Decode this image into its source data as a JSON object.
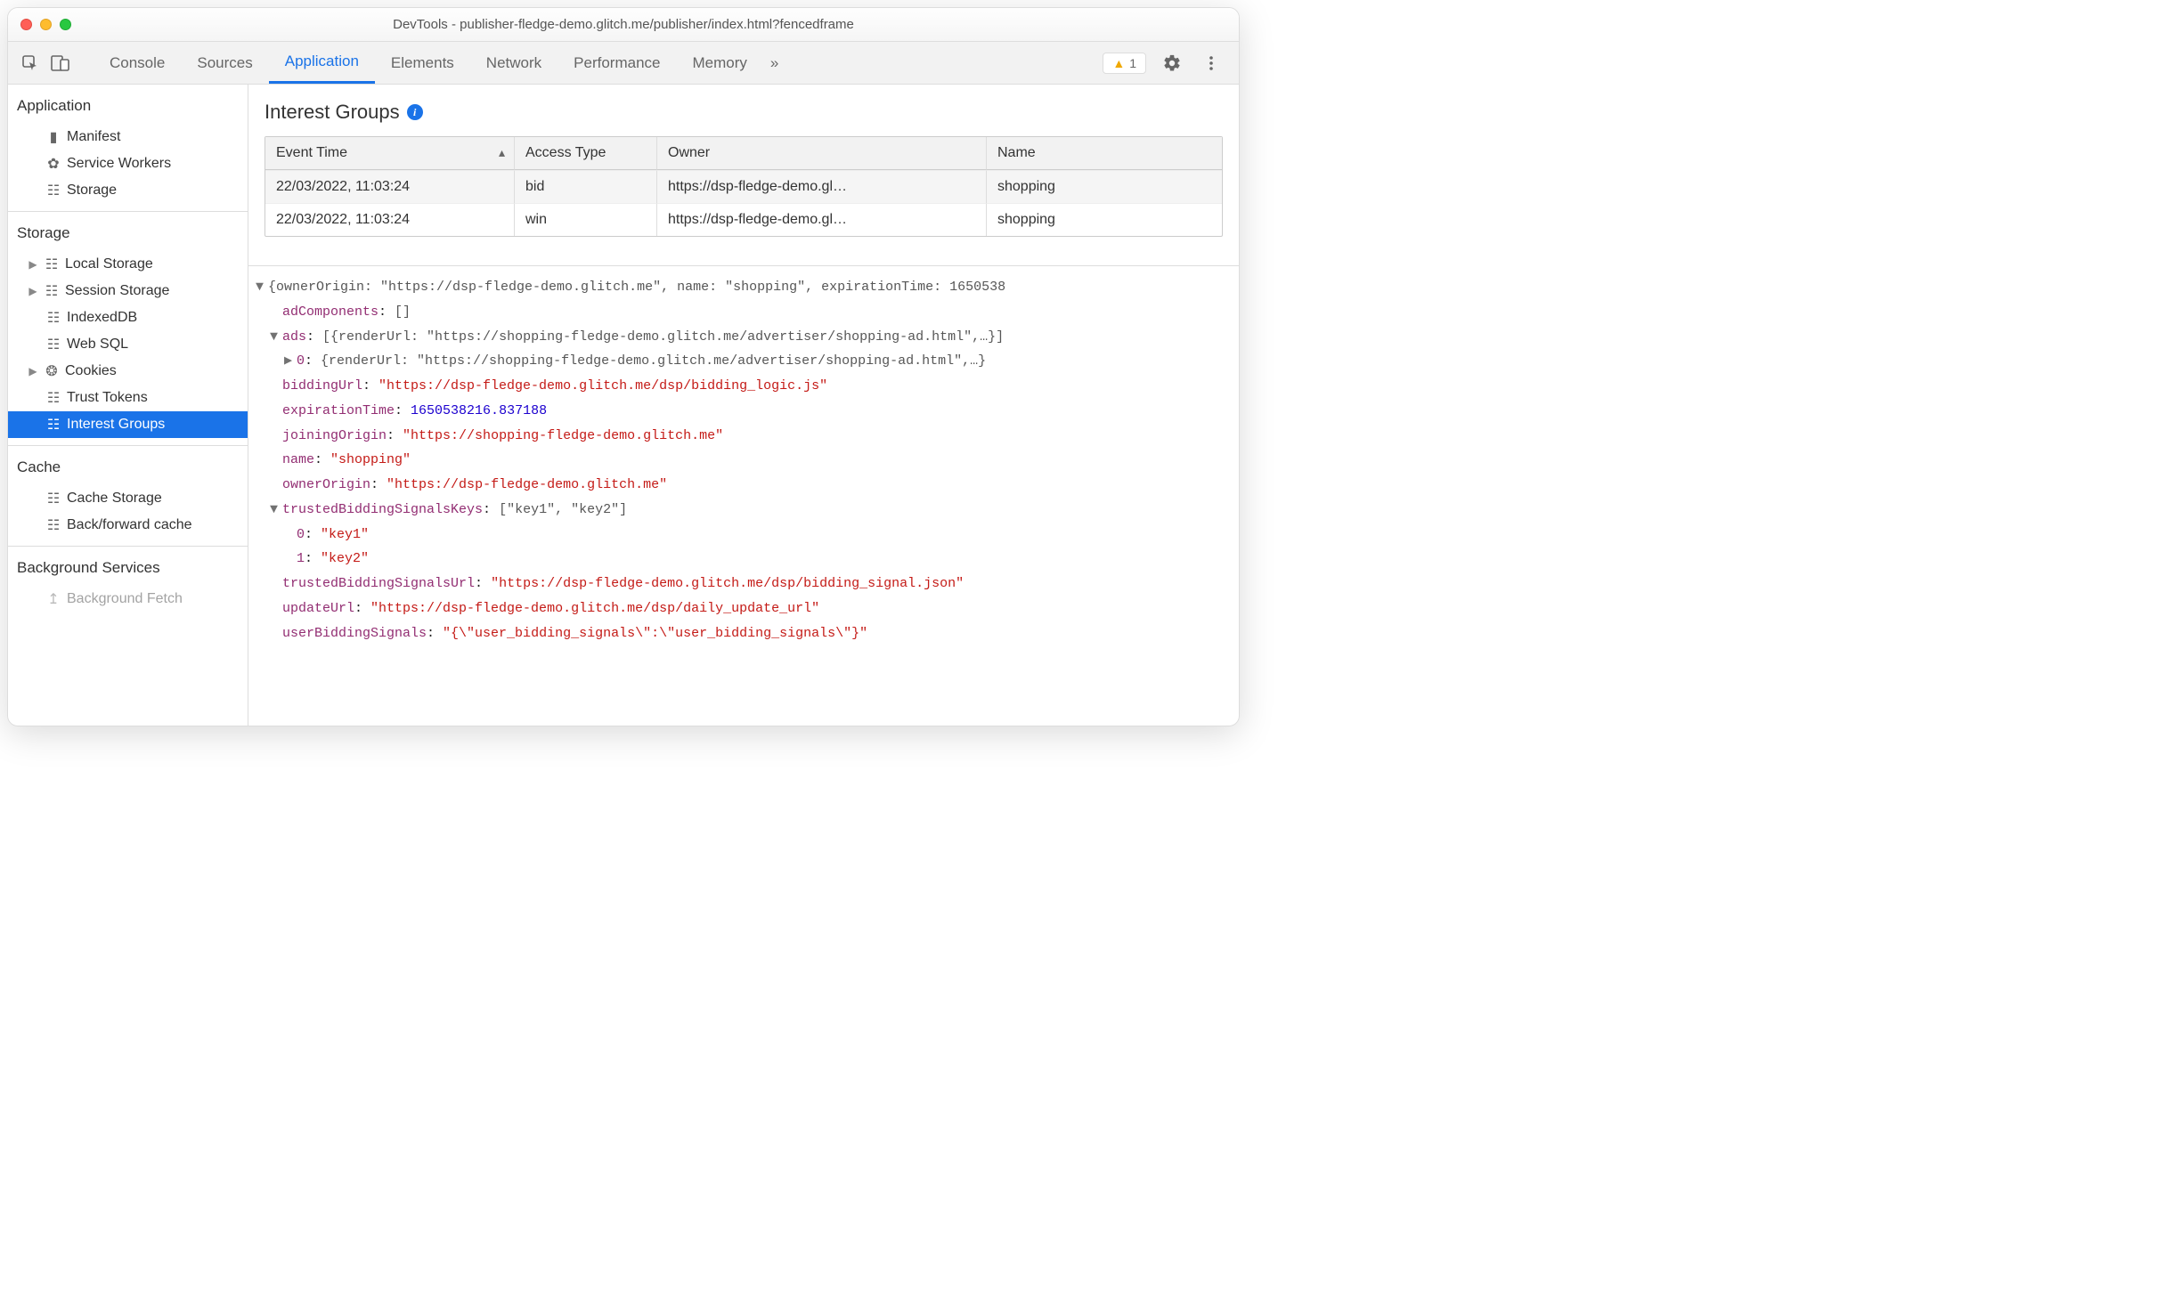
{
  "window_title": "DevTools - publisher-fledge-demo.glitch.me/publisher/index.html?fencedframe",
  "tabs": {
    "t0": "Console",
    "t1": "Sources",
    "t2": "Application",
    "t3": "Elements",
    "t4": "Network",
    "t5": "Performance",
    "t6": "Memory",
    "more": "»"
  },
  "warn_count": "1",
  "sidebar": {
    "application_title": "Application",
    "manifest": "Manifest",
    "service_workers": "Service Workers",
    "storage": "Storage",
    "storage_title": "Storage",
    "local_storage": "Local Storage",
    "session_storage": "Session Storage",
    "indexeddb": "IndexedDB",
    "websql": "Web SQL",
    "cookies": "Cookies",
    "trust_tokens": "Trust Tokens",
    "interest_groups": "Interest Groups",
    "cache_title": "Cache",
    "cache_storage": "Cache Storage",
    "back_forward": "Back/forward cache",
    "bg_title": "Background Services",
    "bg_fetch": "Background Fetch"
  },
  "panel": {
    "heading": "Interest Groups",
    "col_event_time": "Event Time",
    "col_access_type": "Access Type",
    "col_owner": "Owner",
    "col_name": "Name",
    "r0_time": "22/03/2022, 11:03:24",
    "r0_type": "bid",
    "r0_owner": "https://dsp-fledge-demo.gl…",
    "r0_name": "shopping",
    "r1_time": "22/03/2022, 11:03:24",
    "r1_type": "win",
    "r1_owner": "https://dsp-fledge-demo.gl…",
    "r1_name": "shopping"
  },
  "detail": {
    "header_line": "{ownerOrigin: \"https://dsp-fledge-demo.glitch.me\", name: \"shopping\", expirationTime: 1650538",
    "adComponents_key": "adComponents",
    "adComponents_val": "[]",
    "ads_key": "ads",
    "ads_preview": "[{renderUrl: \"https://shopping-fledge-demo.glitch.me/advertiser/shopping-ad.html\",…}]",
    "ads0_idx": "0",
    "ads0_preview": "{renderUrl: \"https://shopping-fledge-demo.glitch.me/advertiser/shopping-ad.html\",…}",
    "biddingUrl_key": "biddingUrl",
    "biddingUrl_val": "\"https://dsp-fledge-demo.glitch.me/dsp/bidding_logic.js\"",
    "expirationTime_key": "expirationTime",
    "expirationTime_val": "1650538216.837188",
    "joiningOrigin_key": "joiningOrigin",
    "joiningOrigin_val": "\"https://shopping-fledge-demo.glitch.me\"",
    "name_key": "name",
    "name_val": "\"shopping\"",
    "ownerOrigin_key": "ownerOrigin",
    "ownerOrigin_val": "\"https://dsp-fledge-demo.glitch.me\"",
    "tbsk_key": "trustedBiddingSignalsKeys",
    "tbsk_preview": "[\"key1\", \"key2\"]",
    "tbsk0_idx": "0",
    "tbsk0_val": "\"key1\"",
    "tbsk1_idx": "1",
    "tbsk1_val": "\"key2\"",
    "tbsu_key": "trustedBiddingSignalsUrl",
    "tbsu_val": "\"https://dsp-fledge-demo.glitch.me/dsp/bidding_signal.json\"",
    "updateUrl_key": "updateUrl",
    "updateUrl_val": "\"https://dsp-fledge-demo.glitch.me/dsp/daily_update_url\"",
    "userBiddingSignals_key": "userBiddingSignals",
    "userBiddingSignals_val": "\"{\\\"user_bidding_signals\\\":\\\"user_bidding_signals\\\"}\""
  }
}
